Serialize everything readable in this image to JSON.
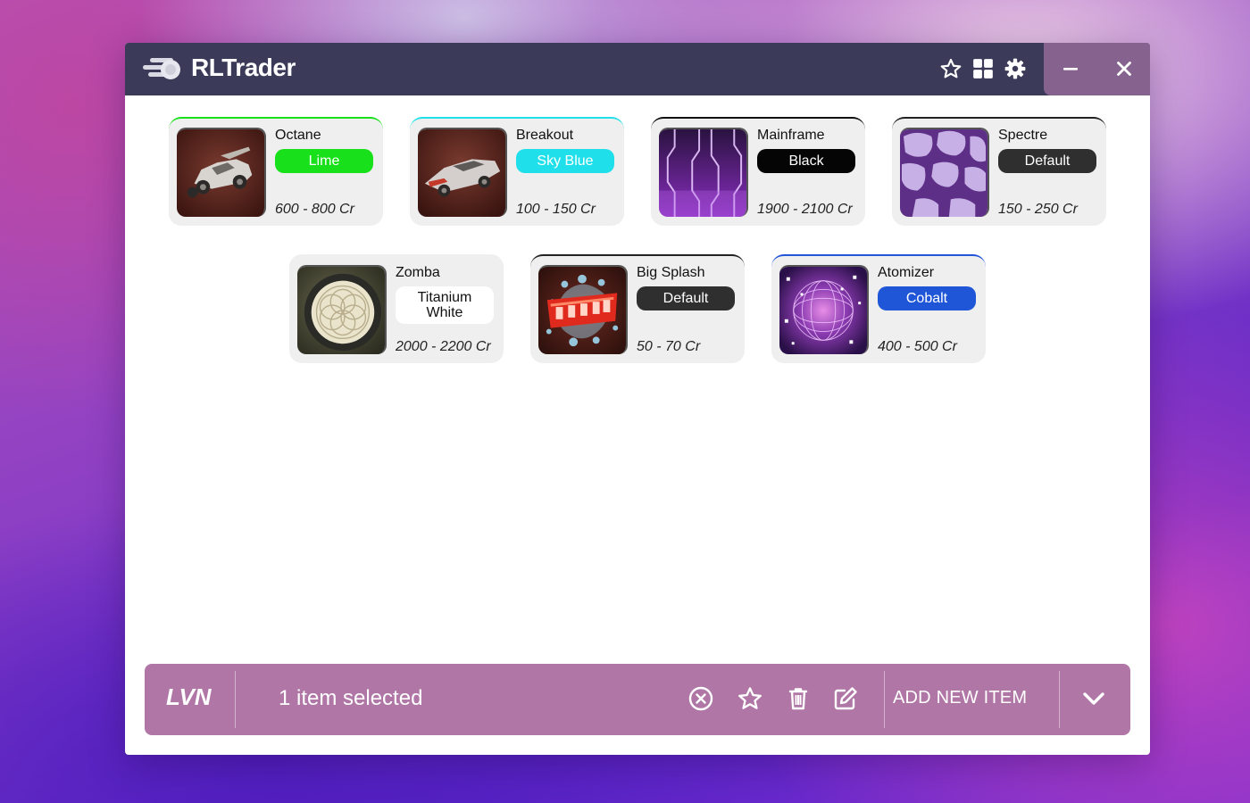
{
  "app": {
    "title": "RLTrader"
  },
  "titlebar_icons": [
    {
      "name": "star-icon"
    },
    {
      "name": "grid-icon"
    },
    {
      "name": "gear-icon"
    }
  ],
  "window_controls": {
    "minimize": "minimize-icon",
    "close": "close-icon"
  },
  "items": [
    {
      "name": "Octane",
      "paint": "Lime",
      "paint_color": "#18e01a",
      "paint_text_color": "#ffffff",
      "price": "600 - 800 Cr",
      "accent": "#18e01a",
      "thumb": "car-octane"
    },
    {
      "name": "Breakout",
      "paint": "Sky Blue",
      "paint_color": "#1fe0ea",
      "paint_text_color": "#ffffff",
      "price": "100 - 150 Cr",
      "accent": "#1fe0ea",
      "thumb": "car-breakout"
    },
    {
      "name": "Mainframe",
      "paint": "Black",
      "paint_color": "#050505",
      "paint_text_color": "#ffffff",
      "price": "1900 - 2100 Cr",
      "accent": "#111111",
      "thumb": "decal-mainframe"
    },
    {
      "name": "Spectre",
      "paint": "Default",
      "paint_color": "#2f2f2f",
      "paint_text_color": "#ffffff",
      "price": "150 - 250 Cr",
      "accent": "#222222",
      "thumb": "decal-spectre"
    },
    {
      "name": "Zomba",
      "paint": "Titanium White",
      "paint_line1": "Titanium",
      "paint_line2": "White",
      "paint_color": "#ffffff",
      "paint_text_color": "#111111",
      "price": "2000 - 2200 Cr",
      "accent": "#efefef",
      "thumb": "wheel-zomba"
    },
    {
      "name": "Big Splash",
      "paint": "Default",
      "paint_color": "#2f2f2f",
      "paint_text_color": "#ffffff",
      "price": "50 - 70 Cr",
      "accent": "#222222",
      "thumb": "goal-big-splash"
    },
    {
      "name": "Atomizer",
      "paint": "Cobalt",
      "paint_color": "#1f56d8",
      "paint_text_color": "#ffffff",
      "price": "400 - 500 Cr",
      "accent": "#1f56d8",
      "thumb": "goal-atomizer"
    }
  ],
  "bottom_bar": {
    "user": "LVN",
    "selection_status": "1 item selected",
    "actions": [
      "deselect-icon",
      "favorite-icon",
      "delete-icon",
      "edit-icon"
    ],
    "add_button_label": "ADD NEW ITEM",
    "dropdown_icon": "chevron-down-icon"
  }
}
